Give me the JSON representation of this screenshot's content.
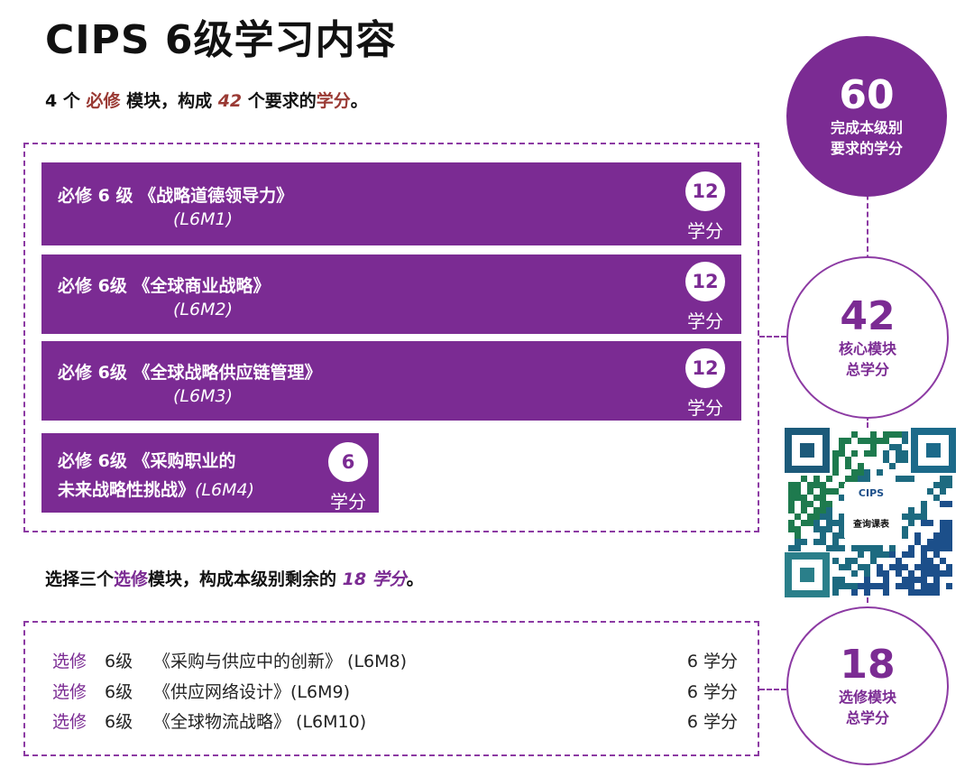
{
  "title": "CIPS 6级学习内容",
  "core_intro": {
    "count": "4 个 ",
    "required": "必修",
    "mid": " 模块，构成 ",
    "credits": "42",
    "tail": " 个要求的",
    "credits_word": "学分",
    "end": "。"
  },
  "core_modules": [
    {
      "line1": "必修 6 级 《战略道德领导力》",
      "code": "(L6M1)",
      "credit": "12",
      "unit": "学分"
    },
    {
      "line1": "必修 6级 《全球商业战略》",
      "code": "(L6M2)",
      "credit": "12",
      "unit": "学分"
    },
    {
      "line1": "必修 6级 《全球战略供应链管理》",
      "code": "(L6M3)",
      "credit": "12",
      "unit": "学分"
    },
    {
      "line1": "必修 6级 《采购职业的",
      "line2": "未来战略性挑战》",
      "code": "(L6M4)",
      "credit": "6",
      "unit": "学分"
    }
  ],
  "elective_intro": {
    "a": "选择三个",
    "optional": "选修",
    "b": "模块，构成本级别剩余的 ",
    "credits": "18 学分",
    "end": "。"
  },
  "electives": [
    {
      "type": "选修",
      "level": "6级",
      "name": "《采购与供应中的创新》  (L6M8)",
      "credit": "6  学分"
    },
    {
      "type": "选修",
      "level": "6级",
      "name": "《供应网络设计》(L6M9)",
      "credit": "6  学分"
    },
    {
      "type": "选修",
      "level": "6级",
      "name": "《全球物流战略》  (L6M10)",
      "credit": "6  学分"
    }
  ],
  "circles": {
    "total": {
      "value": "60",
      "line1": "完成本级别",
      "line2": "要求的学分"
    },
    "core": {
      "value": "42",
      "line1": "核心模块",
      "line2": "总学分"
    },
    "elective": {
      "value": "18",
      "line1": "选修模块",
      "line2": "总学分"
    }
  },
  "qr": {
    "brand": "CIPS",
    "caption": "查询课表"
  },
  "colors": {
    "purple": "#7b2b93",
    "brown": "#9a3a34",
    "dashed": "#8c3aa3"
  }
}
